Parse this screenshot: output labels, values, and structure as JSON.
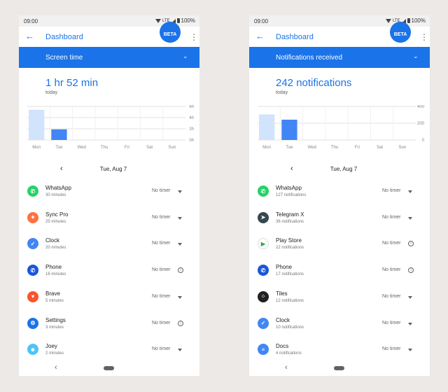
{
  "colors": {
    "accent": "#1a73e8",
    "bar_light": "#d2e3fc",
    "bar_dark": "#4285f4",
    "grid": "#e0e0e0",
    "backdrop": "#ece9e7"
  },
  "phones": [
    {
      "id": "left",
      "statusbar": {
        "time": "09:00",
        "network": "LTE",
        "battery": "100%"
      },
      "appbar": {
        "back_icon": "arrow-left-icon",
        "title": "Dashboard",
        "badge": "BETA",
        "more_icon": "more-vert-icon"
      },
      "selector": {
        "label": "Screen time"
      },
      "summary": {
        "value": "1 hr 52 min",
        "subtitle": "today"
      },
      "chart_data": {
        "type": "bar",
        "categories": [
          "Mon",
          "Tue",
          "Wed",
          "Thu",
          "Fri",
          "Sat",
          "Sun"
        ],
        "values": [
          5.4,
          1.9,
          0,
          0,
          0,
          0,
          0
        ],
        "highlight_index": 1,
        "ylim": [
          0,
          6
        ],
        "yticks": [
          0,
          2,
          4,
          6
        ],
        "ytick_labels": [
          "0h",
          "2h",
          "4h",
          "6h"
        ],
        "grid": true
      },
      "datenav": {
        "prev_icon": "chevron-left-icon",
        "date": "Tue, Aug 7"
      },
      "apps": [
        {
          "name": "WhatsApp",
          "sub": "30 minutes",
          "timer": "No timer",
          "action": "dropdown",
          "icon": "whatsapp-icon",
          "icon_color": "#25d366",
          "glyph": "✆"
        },
        {
          "name": "Sync Pro",
          "sub": "25 minutes",
          "timer": "No timer",
          "action": "dropdown",
          "icon": "sync-pro-icon",
          "icon_color": "#ff7043",
          "glyph": "✦"
        },
        {
          "name": "Clock",
          "sub": "20 minutes",
          "timer": "No timer",
          "action": "dropdown",
          "icon": "clock-icon",
          "icon_color": "#4285f4",
          "glyph": "✓"
        },
        {
          "name": "Phone",
          "sub": "16 minutes",
          "timer": "No timer",
          "action": "info",
          "icon": "phone-icon",
          "icon_color": "#1a56db",
          "glyph": "✆"
        },
        {
          "name": "Brave",
          "sub": "5 minutes",
          "timer": "No timer",
          "action": "dropdown",
          "icon": "brave-icon",
          "icon_color": "#fb542b",
          "glyph": "♥"
        },
        {
          "name": "Settings",
          "sub": "3 minutes",
          "timer": "No timer",
          "action": "info",
          "icon": "settings-icon",
          "icon_color": "#1a73e8",
          "glyph": "⚙"
        },
        {
          "name": "Joey",
          "sub": "2 minutes",
          "timer": "No timer",
          "action": "dropdown",
          "icon": "joey-icon",
          "icon_color": "#4fc3f7",
          "glyph": "☻"
        }
      ],
      "navbar": {
        "back_icon": "nav-back-icon",
        "home_icon": "home-pill-icon"
      }
    },
    {
      "id": "right",
      "statusbar": {
        "time": "09:00",
        "network": "LTE",
        "battery": "100%"
      },
      "appbar": {
        "back_icon": "arrow-left-icon",
        "title": "Dashboard",
        "badge": "BETA",
        "more_icon": "more-vert-icon"
      },
      "selector": {
        "label": "Notifications received"
      },
      "summary": {
        "value": "242 notifications",
        "subtitle": "today"
      },
      "chart_data": {
        "type": "bar",
        "categories": [
          "Mon",
          "Tue",
          "Wed",
          "Thu",
          "Fri",
          "Sat",
          "Sun"
        ],
        "values": [
          305,
          242,
          0,
          0,
          0,
          0,
          0
        ],
        "highlight_index": 1,
        "ylim": [
          0,
          400
        ],
        "yticks": [
          0,
          200,
          400
        ],
        "ytick_labels": [
          "0",
          "200",
          "400"
        ],
        "grid": true
      },
      "datenav": {
        "prev_icon": "chevron-left-icon",
        "date": "Tue, Aug 7"
      },
      "apps": [
        {
          "name": "WhatsApp",
          "sub": "127 notifications",
          "timer": "No timer",
          "action": "dropdown",
          "icon": "whatsapp-icon",
          "icon_color": "#25d366",
          "glyph": "✆"
        },
        {
          "name": "Telegram X",
          "sub": "36 notifications",
          "timer": "No timer",
          "action": "dropdown",
          "icon": "telegram-x-icon",
          "icon_color": "#37474f",
          "glyph": "➤"
        },
        {
          "name": "Play Store",
          "sub": "22 notifications",
          "timer": "No timer",
          "action": "info",
          "icon": "play-store-icon",
          "icon_color": "#ffffff",
          "glyph": "▶"
        },
        {
          "name": "Phone",
          "sub": "17 notifications",
          "timer": "No timer",
          "action": "info",
          "icon": "phone-icon",
          "icon_color": "#1a56db",
          "glyph": "✆"
        },
        {
          "name": "Tiles",
          "sub": "12 notifications",
          "timer": "No timer",
          "action": "dropdown",
          "icon": "tiles-icon",
          "icon_color": "#212121",
          "glyph": "⁘"
        },
        {
          "name": "Clock",
          "sub": "10 notifications",
          "timer": "No timer",
          "action": "dropdown",
          "icon": "clock-icon",
          "icon_color": "#4285f4",
          "glyph": "✓"
        },
        {
          "name": "Docs",
          "sub": "4 notifications",
          "timer": "No timer",
          "action": "dropdown",
          "icon": "docs-icon",
          "icon_color": "#4285f4",
          "glyph": "≡"
        }
      ],
      "navbar": {
        "back_icon": "nav-back-icon",
        "home_icon": "home-pill-icon"
      }
    }
  ]
}
